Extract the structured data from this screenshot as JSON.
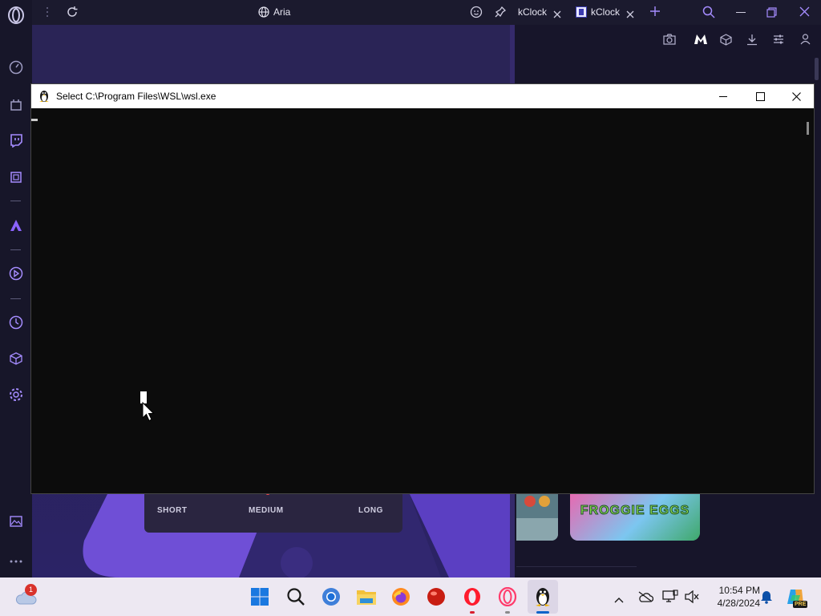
{
  "browser": {
    "tab_title": "Aria",
    "tabs": [
      {
        "label": "kClock"
      },
      {
        "label": "kClock"
      }
    ]
  },
  "terminal": {
    "title": "Select C:\\Program Files\\WSL\\wsl.exe"
  },
  "timer": {
    "options": [
      "SHORT",
      "MEDIUM",
      "LONG"
    ]
  },
  "game_tile": {
    "title": "FROGGIE EGGS"
  },
  "taskbar": {
    "weather_badge": "1",
    "time": "10:54 PM",
    "date": "4/28/2024",
    "pre_badge": "PRE"
  },
  "colors": {
    "sidebar_bg": "#171629",
    "accent_purple": "#7b5cff",
    "terminal_bg": "#0c0c0c",
    "taskbar_bg": "#ede8f2"
  }
}
